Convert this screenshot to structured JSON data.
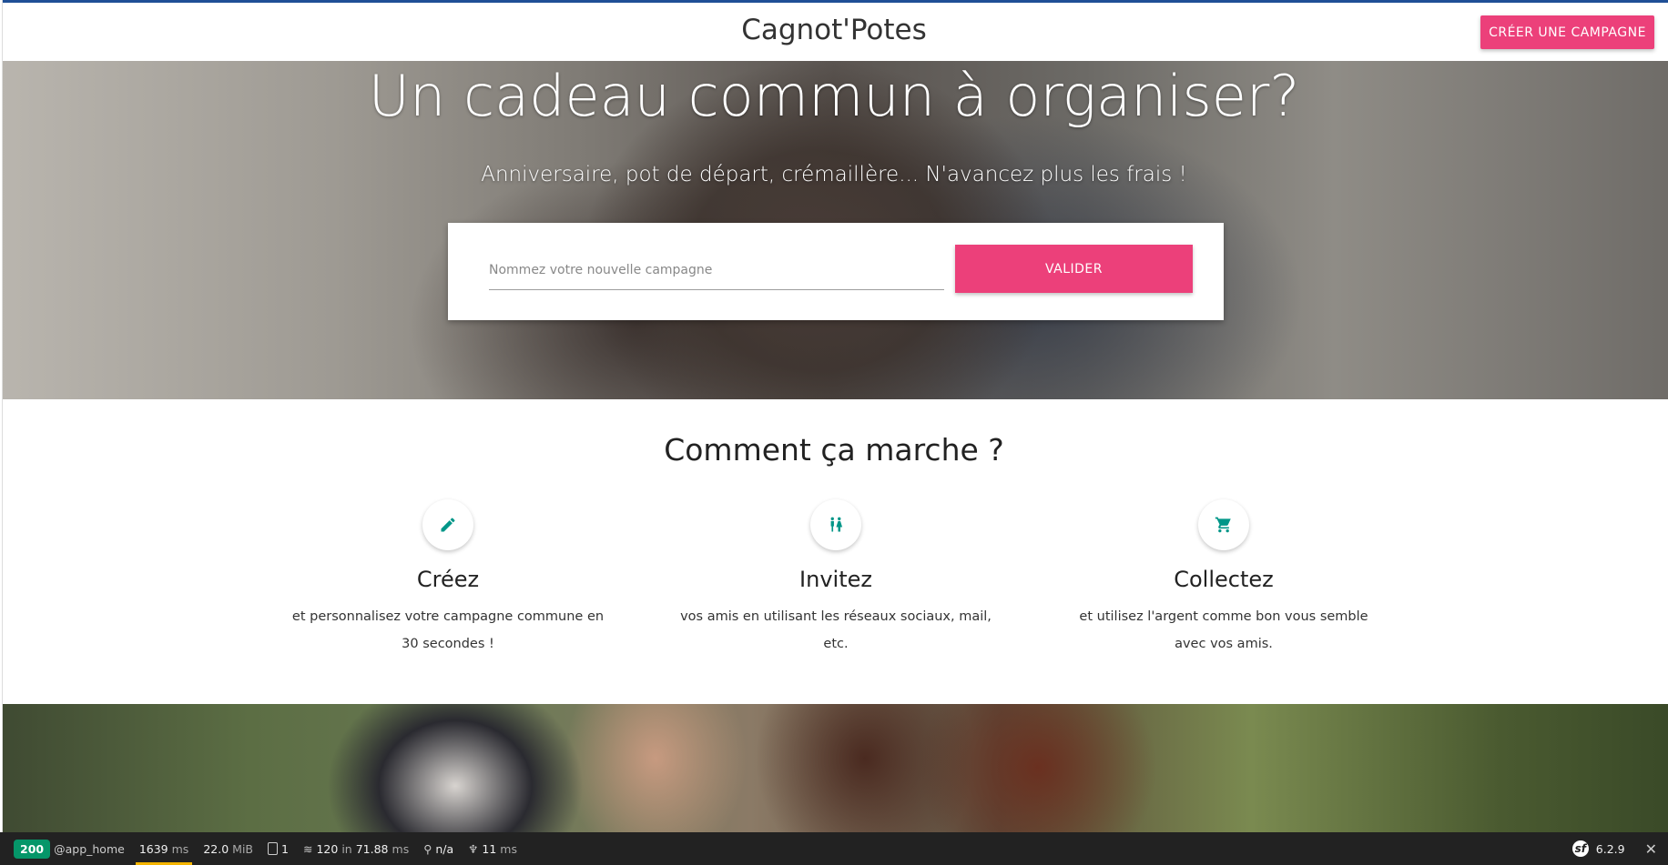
{
  "header": {
    "brand": "Cagnot'Potes",
    "cta_label": "CRÉER UNE CAMPAGNE"
  },
  "hero": {
    "title": "Un cadeau commun à organiser?",
    "subtitle": "Anniversaire, pot de départ, crémaillère... N'avancez plus les frais !",
    "input_placeholder": "Nommez votre nouvelle campagne",
    "submit_label": "VALIDER"
  },
  "how": {
    "title": "Comment ça marche ?",
    "steps": [
      {
        "icon": "pencil-icon",
        "title": "Créez",
        "text": "et personnalisez votre campagne commune en 30 secondes !"
      },
      {
        "icon": "people-icon",
        "title": "Invitez",
        "text": "vos amis en utilisant les réseaux sociaux, mail, etc."
      },
      {
        "icon": "cart-icon",
        "title": "Collectez",
        "text": "et utilisez l'argent comme bon vous semble avec vos amis."
      }
    ]
  },
  "colors": {
    "accent": "#ec407a",
    "icon": "#009688",
    "status": "#059669"
  },
  "debug_toolbar": {
    "status": "200",
    "route": "@app_home",
    "time": "1639",
    "time_unit": "ms",
    "memory": "22.0",
    "memory_unit": "MiB",
    "logs": "1",
    "queries": "120",
    "queries_in": "in",
    "queries_time": "71.88",
    "queries_unit": "ms",
    "user": "n/a",
    "twig_time": "11",
    "twig_unit": "ms",
    "version": "6.2.9"
  }
}
